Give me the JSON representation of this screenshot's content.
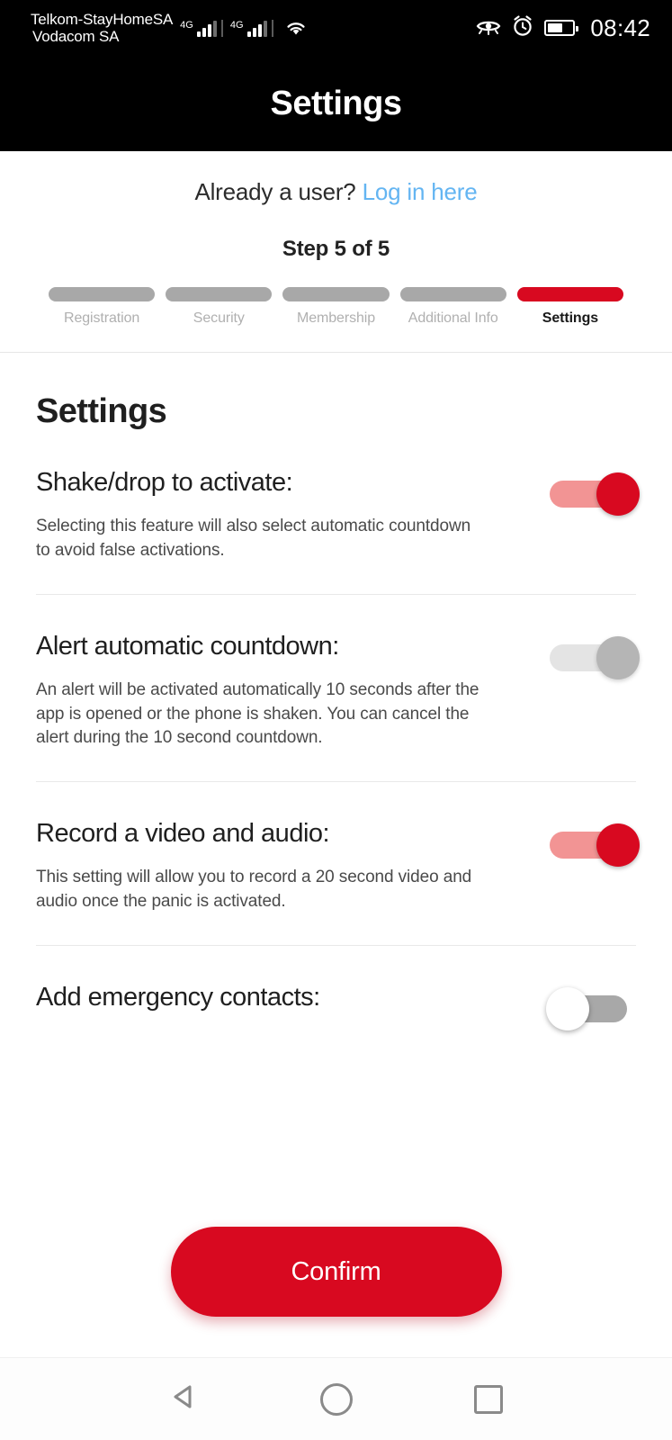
{
  "status_bar": {
    "carrier_primary": "Telkom-StayHomeSA",
    "carrier_secondary": "Vodacom SA",
    "network_1": "4G",
    "network_2": "4G",
    "wifi_icon": "wifi-icon",
    "eye_icon": "eye-icon",
    "alarm_icon": "alarm-clock-icon",
    "battery_icon": "battery-icon",
    "battery_level": "58",
    "time": "08:42"
  },
  "header": {
    "title": "Settings"
  },
  "top_panel": {
    "login_prompt": "Already a user?",
    "login_link": "Log in here",
    "step_label": "Step 5 of 5",
    "steps": [
      {
        "label": "Registration",
        "active": false
      },
      {
        "label": "Security",
        "active": false
      },
      {
        "label": "Membership",
        "active": false
      },
      {
        "label": "Additional Info",
        "active": false
      },
      {
        "label": "Settings",
        "active": true
      }
    ]
  },
  "main": {
    "section_title": "Settings",
    "settings": [
      {
        "label": "Shake/drop to activate:",
        "description": "Selecting this feature will also select automatic countdown to avoid false activations.",
        "toggle_state": "on"
      },
      {
        "label": "Alert automatic countdown:",
        "description": "An alert will be activated automatically 10 seconds after the app is opened or the phone is shaken. You can cancel the alert during the 10 second countdown.",
        "toggle_state": "on-disabled"
      },
      {
        "label": "Record a video and audio:",
        "description": "This setting will allow you to record a 20 second video and audio once the panic is activated.",
        "toggle_state": "on"
      },
      {
        "label": "Add emergency contacts:",
        "description": "",
        "toggle_state": "off"
      }
    ]
  },
  "footer": {
    "confirm_label": "Confirm"
  },
  "nav_bar": {
    "back_icon": "back-triangle-icon",
    "home_icon": "home-circle-icon",
    "recents_icon": "recents-square-icon"
  },
  "colors": {
    "brand_red": "#d80920",
    "link_blue": "#64b5f2",
    "status_bg": "#000000",
    "toggle_on_track": "#f29494",
    "toggle_off_track": "#a8a8a8"
  }
}
